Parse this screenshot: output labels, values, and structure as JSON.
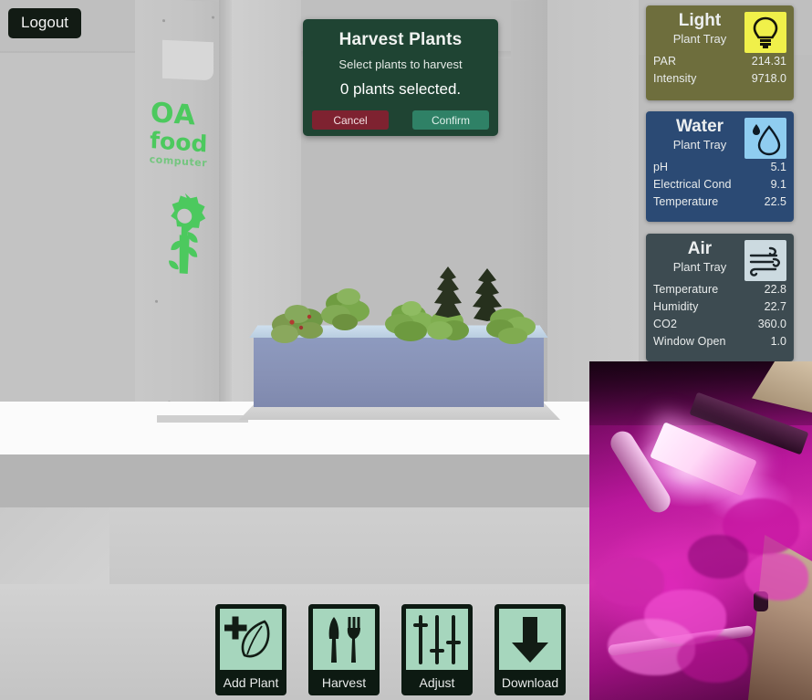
{
  "app": {
    "logout_label": "Logout"
  },
  "dialog": {
    "title": "Harvest Plants",
    "subtitle": "Select plants to harvest",
    "count_text": "0 plants selected.",
    "cancel_label": "Cancel",
    "confirm_label": "Confirm",
    "bg_color": "#1f4433",
    "cancel_color": "#7e2230",
    "confirm_color": "#2f8166"
  },
  "scene": {
    "logo_line1": "OA",
    "logo_line2": "food",
    "logo_line3": "computer",
    "logo_color": "#4cc95e"
  },
  "sensors": [
    {
      "id": "light",
      "title": "Light",
      "subtitle": "Plant Tray",
      "icon": "lightbulb-icon",
      "bg_color": "#6e6e3d",
      "icon_bg": "#f0f04a",
      "rows": [
        {
          "key": "PAR",
          "value": "214.31"
        },
        {
          "key": "Intensity",
          "value": "9718.0"
        }
      ]
    },
    {
      "id": "water",
      "title": "Water",
      "subtitle": "Plant Tray",
      "icon": "water-drop-icon",
      "bg_color": "#2b4a74",
      "icon_bg": "#8fcdf0",
      "rows": [
        {
          "key": "pH",
          "value": "5.1"
        },
        {
          "key": "Electrical Cond",
          "value": "9.1"
        },
        {
          "key": "Temperature",
          "value": "22.5"
        }
      ]
    },
    {
      "id": "air",
      "title": "Air",
      "subtitle": "Plant Tray",
      "icon": "wind-icon",
      "bg_color": "#3d4b51",
      "icon_bg": "#ccdae0",
      "rows": [
        {
          "key": "Temperature",
          "value": "22.8"
        },
        {
          "key": "Humidity",
          "value": "22.7"
        },
        {
          "key": "CO2",
          "value": "360.0"
        },
        {
          "key": "Window Open",
          "value": "1.0"
        }
      ]
    }
  ],
  "toolbar": {
    "buttons": [
      {
        "id": "add-plant",
        "label": "Add Plant",
        "icon": "seed-plus-icon"
      },
      {
        "id": "harvest",
        "label": "Harvest",
        "icon": "knife-fork-icon"
      },
      {
        "id": "adjust",
        "label": "Adjust",
        "icon": "sliders-icon"
      },
      {
        "id": "download",
        "label": "Download",
        "icon": "down-arrow-icon"
      }
    ],
    "icon_bg": "#a6d6bd",
    "button_bg": "#0d1a12"
  },
  "webcam": {
    "caption": "",
    "light_color": "#e033b8"
  }
}
